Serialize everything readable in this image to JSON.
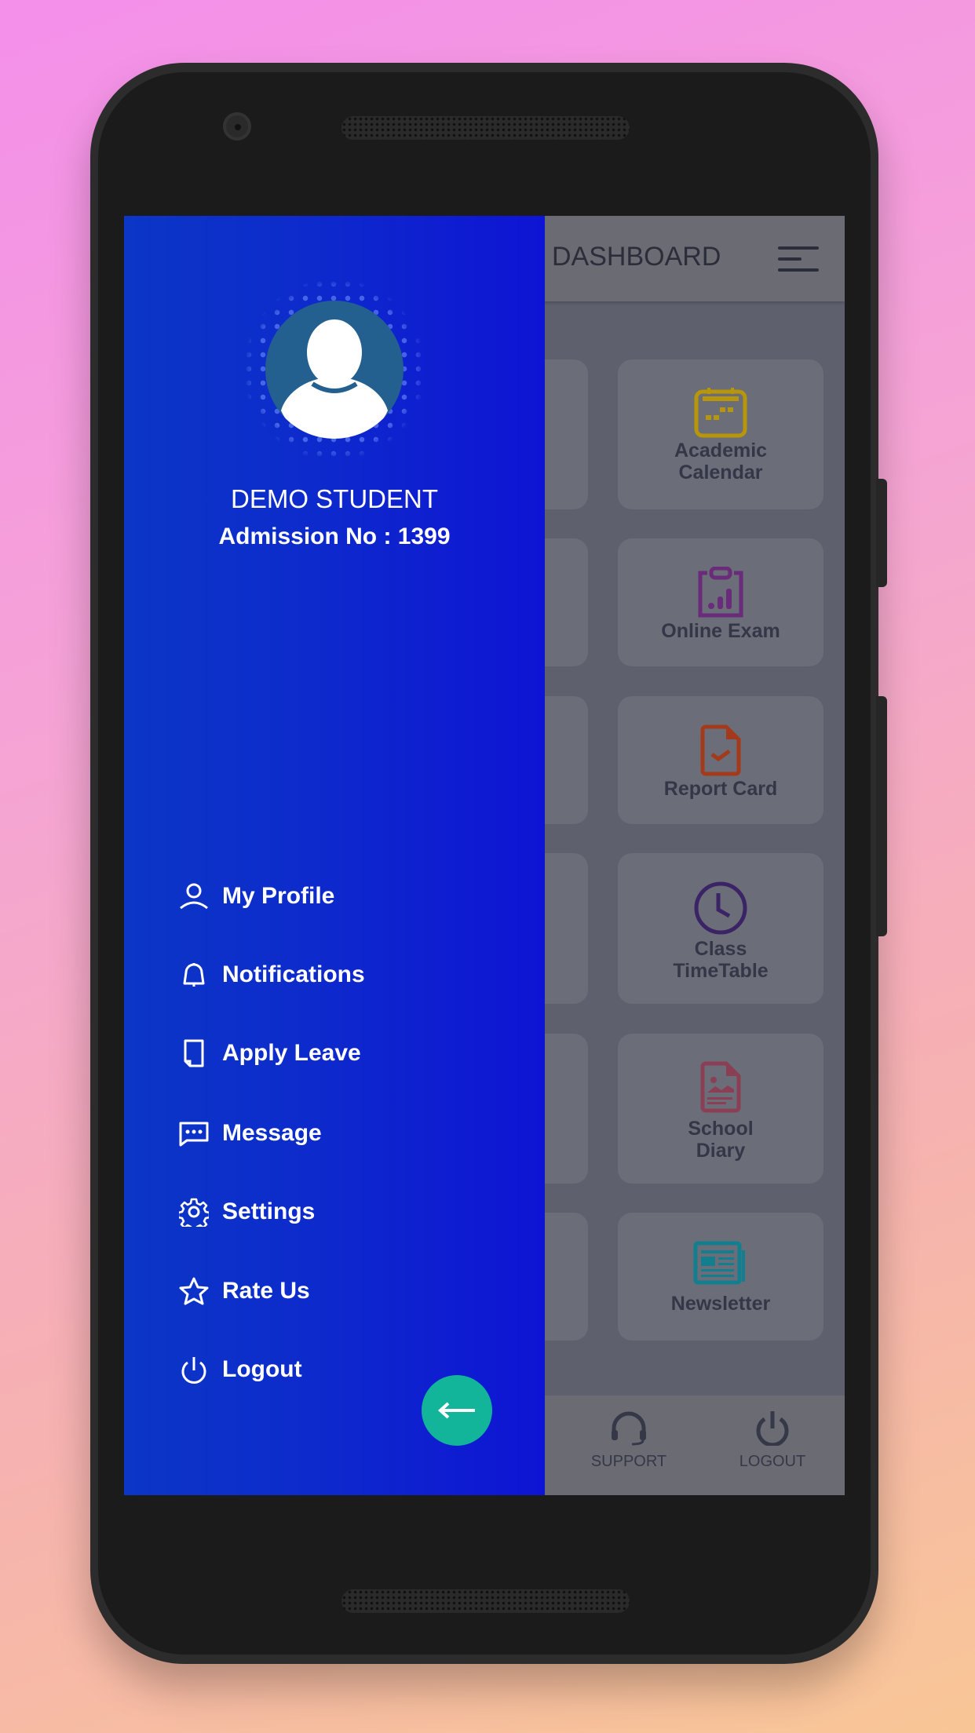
{
  "dashboard": {
    "title": "DASHBOARD",
    "cards": [
      {
        "label": "Academic Calendar",
        "icon": "calendar-icon",
        "color": "#b8960a"
      },
      {
        "label": "Online Exam",
        "icon": "clipboard-chart-icon",
        "color": "#6a2b7a"
      },
      {
        "label": "Report Card",
        "icon": "document-check-icon",
        "color": "#a33a1c"
      },
      {
        "label": "Class TimeTable",
        "icon": "clock-icon",
        "color": "#3b2466"
      },
      {
        "label": "School Diary",
        "icon": "document-image-icon",
        "color": "#8a3f55"
      },
      {
        "label": "Newsletter",
        "icon": "newspaper-icon",
        "color": "#137f8e"
      }
    ],
    "bottom_nav": [
      {
        "label": "SUPPORT",
        "icon": "headset-icon"
      },
      {
        "label": "LOGOUT",
        "icon": "power-icon"
      }
    ]
  },
  "drawer": {
    "user_name": "DEMO STUDENT",
    "admission": "Admission No : 1399",
    "menu": [
      {
        "label": "My Profile",
        "icon": "user-icon"
      },
      {
        "label": "Notifications",
        "icon": "bell-icon"
      },
      {
        "label": "Apply Leave",
        "icon": "document-icon"
      },
      {
        "label": "Message",
        "icon": "chat-icon"
      },
      {
        "label": "Settings",
        "icon": "gear-icon"
      },
      {
        "label": "Rate Us",
        "icon": "star-icon"
      },
      {
        "label": "Logout",
        "icon": "power-icon"
      }
    ],
    "close_icon": "arrow-left-icon",
    "fab_color": "#12b59a"
  }
}
